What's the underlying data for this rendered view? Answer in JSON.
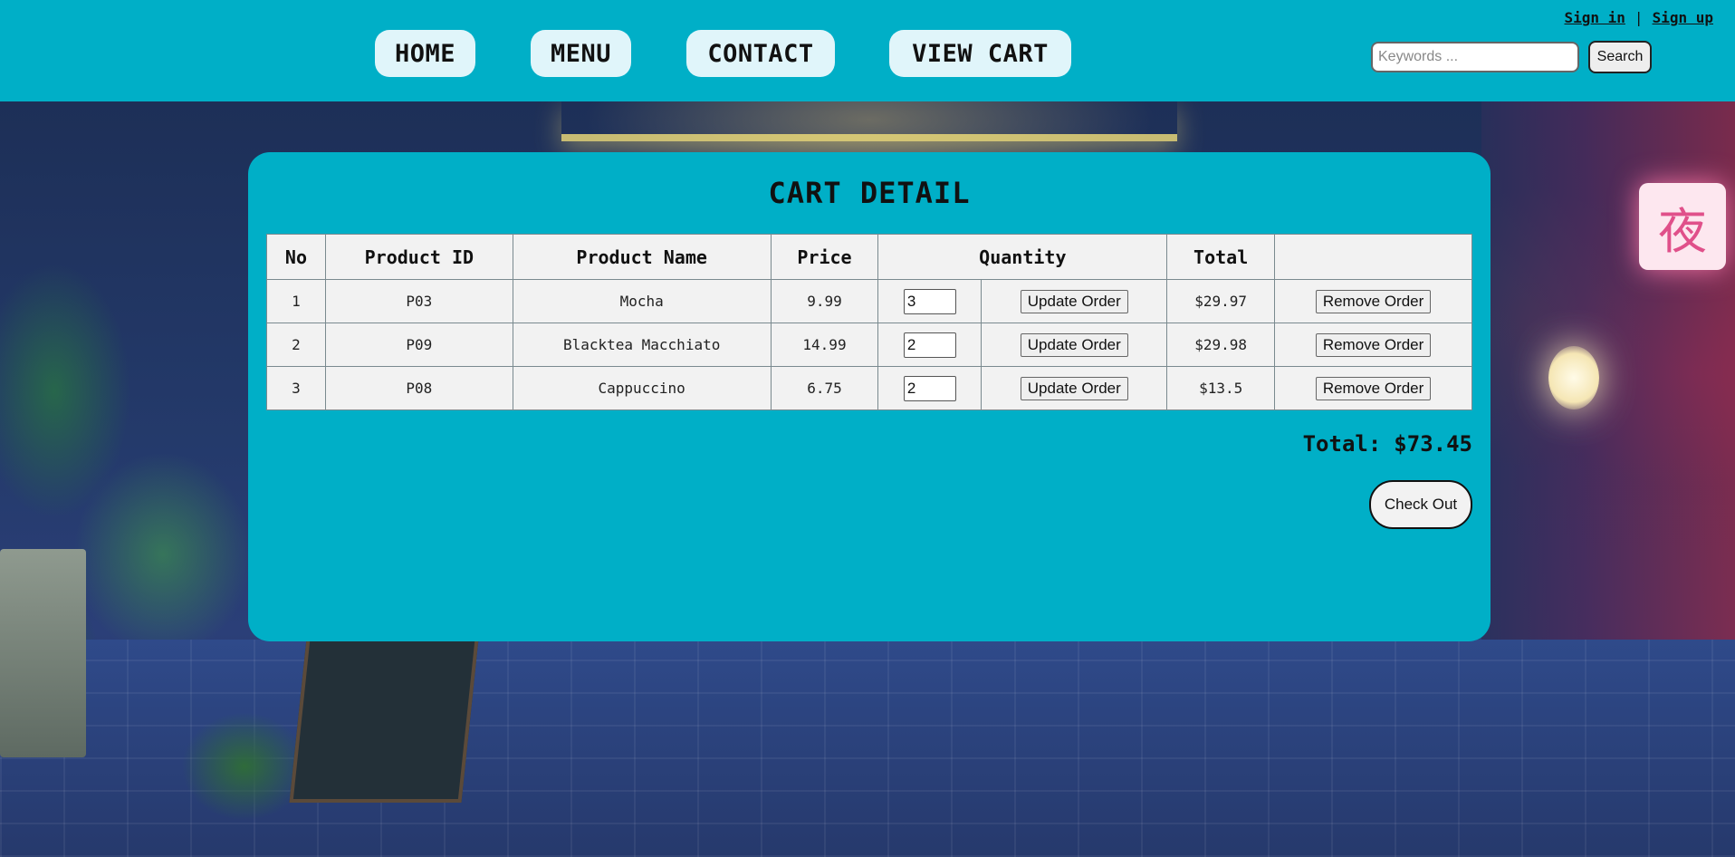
{
  "nav": {
    "home": "HOME",
    "menu": "MENU",
    "contact": "CONTACT",
    "view_cart": "VIEW CART"
  },
  "auth": {
    "sign_in": "Sign in",
    "separator": "|",
    "sign_up": "Sign up"
  },
  "search": {
    "placeholder": "Keywords ...",
    "button_label": "Search"
  },
  "cart": {
    "title": "CART DETAIL",
    "columns": [
      "No",
      "Product ID",
      "Product Name",
      "Price",
      "Quantity",
      "Total",
      ""
    ],
    "rows": [
      {
        "no": "1",
        "product_id": "P03",
        "product_name": "Mocha",
        "price": "9.99",
        "quantity": "3",
        "update_label": "Update Order",
        "total": "$29.97",
        "remove_label": "Remove Order"
      },
      {
        "no": "2",
        "product_id": "P09",
        "product_name": "Blacktea Macchiato",
        "price": "14.99",
        "quantity": "2",
        "update_label": "Update Order",
        "total": "$29.98",
        "remove_label": "Remove Order"
      },
      {
        "no": "3",
        "product_id": "P08",
        "product_name": "Cappuccino",
        "price": "6.75",
        "quantity": "2",
        "update_label": "Update Order",
        "total": "$13.5",
        "remove_label": "Remove Order"
      }
    ],
    "grand_total_label": "Total:",
    "grand_total_value": "$73.45",
    "checkout_label": "Check Out"
  },
  "background": {
    "sign_text": "夜"
  },
  "colors": {
    "header_bg": "#00afc7",
    "panel_bg": "#00afc7",
    "nav_button_bg": "#e0f5fa",
    "table_bg": "#f2f2f2"
  }
}
